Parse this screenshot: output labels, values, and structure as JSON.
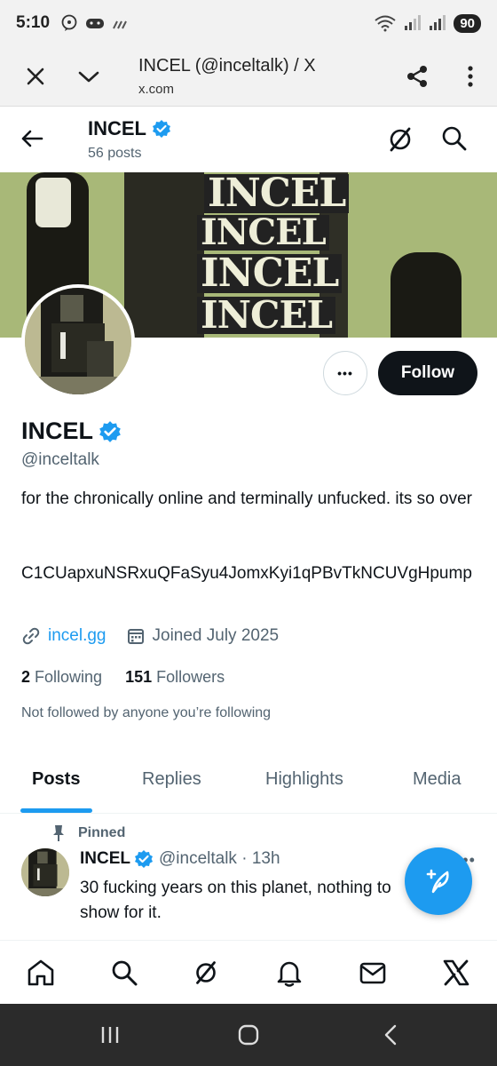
{
  "status_bar": {
    "time": "5:10",
    "battery": "90"
  },
  "browser": {
    "page_title": "INCEL (@inceltalk) / X",
    "url": "x.com"
  },
  "header": {
    "name": "INCEL",
    "posts_count": "56 posts"
  },
  "banner": {
    "words": [
      "INCEL",
      "INCEL",
      "INCEL",
      "INCEL"
    ]
  },
  "profile": {
    "more_label": "•••",
    "follow_label": "Follow",
    "name": "INCEL",
    "handle": "@inceltalk",
    "bio": "for the chronically online and terminally unfucked. its so over",
    "bio_code": "C1CUapxuNSRxuQFaSyu4JomxKyi1qPBvTkNCUVgHpump",
    "link": "incel.gg",
    "joined": "Joined July 2025",
    "following_count": "2",
    "following_label": "Following",
    "followers_count": "151",
    "followers_label": "Followers",
    "not_followed": "Not followed by anyone you’re following"
  },
  "tabs": [
    {
      "label": "Posts"
    },
    {
      "label": "Replies"
    },
    {
      "label": "Highlights"
    },
    {
      "label": "Media"
    }
  ],
  "tweet": {
    "pinned_label": "Pinned",
    "name": "INCEL",
    "handle_time": "@inceltalk · 13h",
    "more": "•••",
    "text": "30 fucking years on this planet, nothing to show for it."
  },
  "colors": {
    "accent": "#1d9bf0",
    "text": "#0f1419",
    "secondary": "#536471"
  }
}
